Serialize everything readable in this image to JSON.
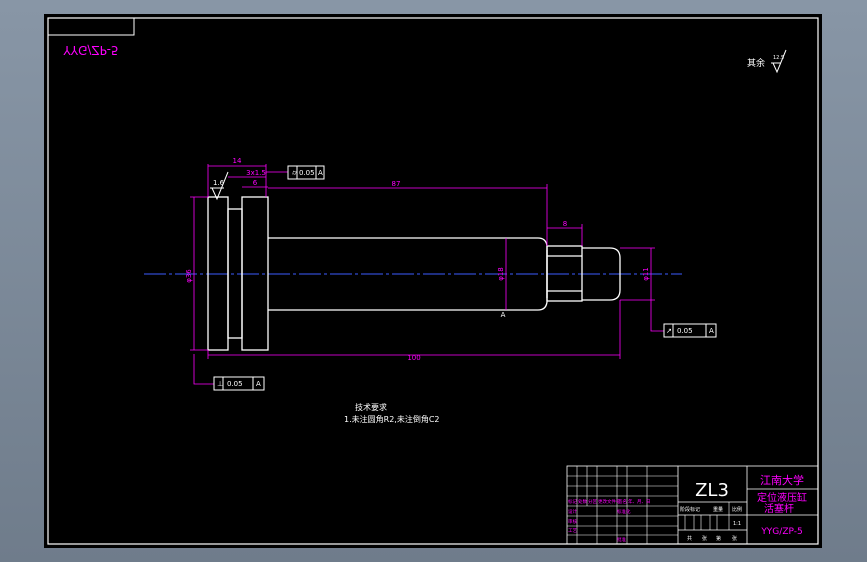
{
  "drawing_code_mirrored": "YYG/ZP-5",
  "roughness": {
    "label": "其余",
    "value": "12.5"
  },
  "callouts": {
    "roughness_left": "1.6",
    "gdt_top": {
      "sym": "⌭",
      "tol": "0.05",
      "datum": "A"
    },
    "gdt_bottom": {
      "sym": "⊥",
      "tol": "0.05",
      "datum": "A"
    },
    "gdt_right": {
      "sym": "↗",
      "tol": "0.05",
      "datum": "A"
    }
  },
  "dimensions": {
    "top_width": "14",
    "groove": "3x1.5",
    "flange": "6",
    "length_long": "87",
    "step": "8",
    "dia_main": "φ36",
    "dia_mid": "φ18",
    "dia_small": "φ11",
    "total": "100",
    "marker": "A"
  },
  "notes": {
    "title": "技术要求",
    "line1": "1.未注圆角R2,未注倒角C2"
  },
  "title_block": {
    "material": "ZL3",
    "company": "江南大学",
    "name_line1": "定位液压缸",
    "name_line2": "活塞杆",
    "drawing_no": "YYG/ZP-5",
    "headers": [
      "标记",
      "处数",
      "分区",
      "更改文件号",
      "签名",
      "年、月、日"
    ],
    "roles": [
      "设计",
      "标准化",
      "审核",
      "工艺",
      "批准"
    ],
    "stage": "阶段标记",
    "weight": "重量",
    "scale": "比例",
    "scale_value": "1:1",
    "sheet_info": [
      "共",
      "张",
      "第",
      "张"
    ]
  },
  "colors": {
    "outline": "#ffffff",
    "dimension": "#ff00ff",
    "centerline": "#3b5bff",
    "border": "#ffffff"
  }
}
